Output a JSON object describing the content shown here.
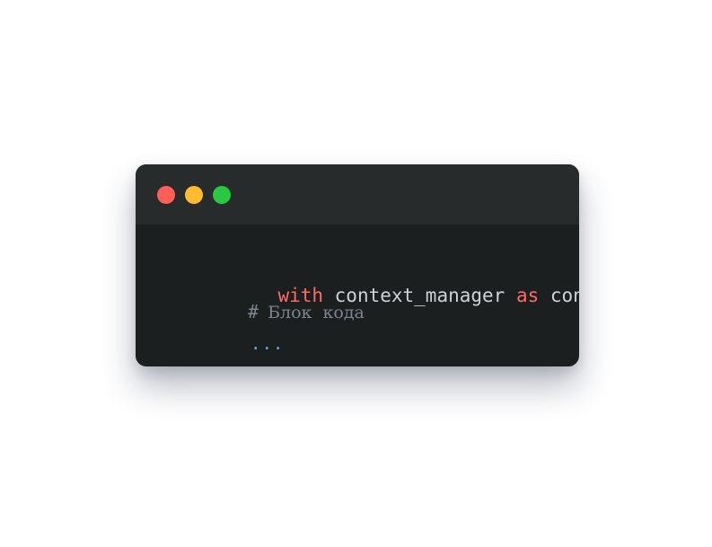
{
  "window_controls": {
    "close_color": "#fe5f57",
    "minimize_color": "#febc2e",
    "zoom_color": "#28c840"
  },
  "colors": {
    "window_bg": "#1c1f20",
    "titlebar_bg": "#282b2c",
    "keyword": "#ff6b62",
    "plain": "#ccd3d6",
    "comment": "#7b868d",
    "ellipsis": "#7aa8e8"
  },
  "code": {
    "line1": {
      "kw_with": "with",
      "expr": " context_manager ",
      "kw_as": "as",
      "target": " context:"
    },
    "line2": {
      "hash": "#",
      "comment": " Блок  кода"
    },
    "line3": {
      "ellipsis": "..."
    }
  }
}
